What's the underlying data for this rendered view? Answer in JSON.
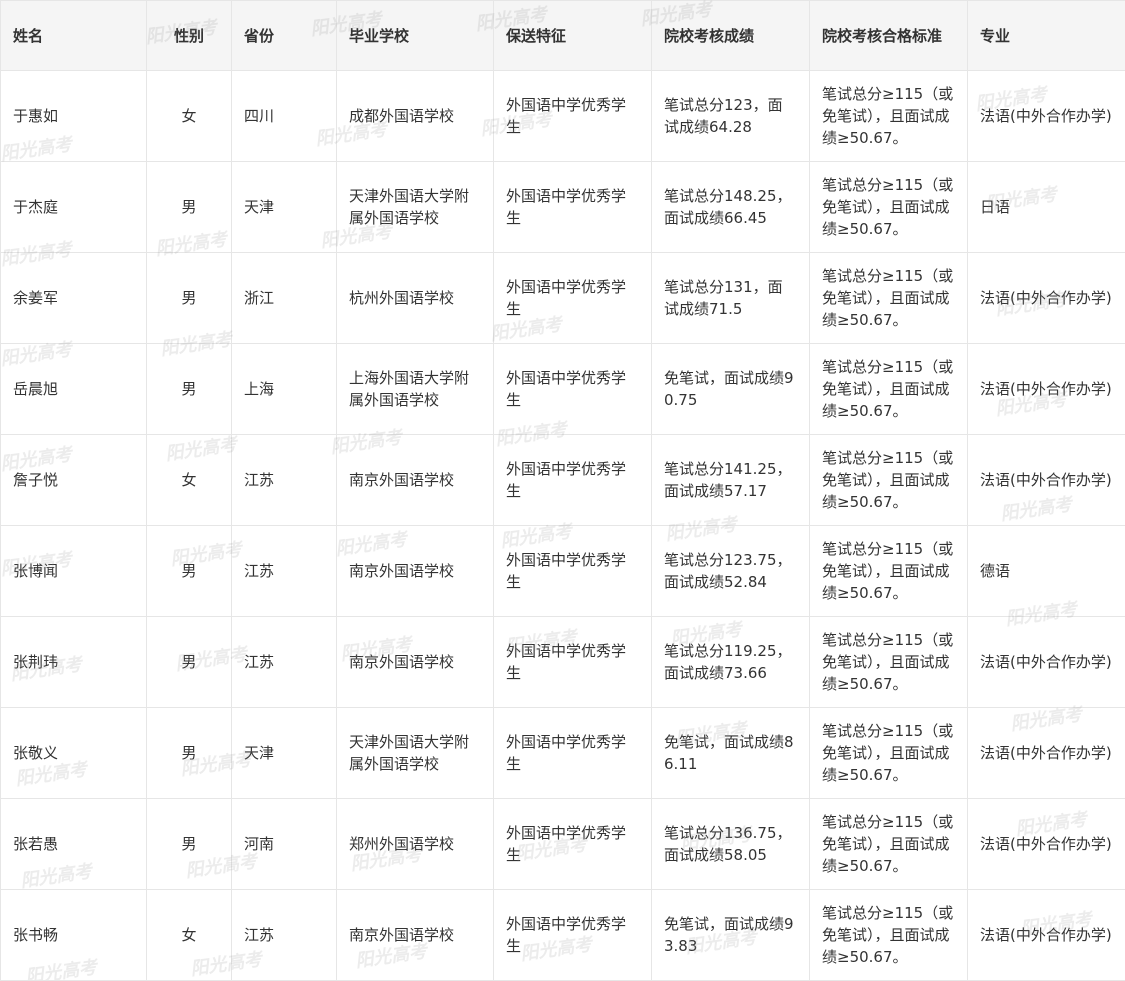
{
  "table": {
    "headers": [
      "姓名",
      "性别",
      "省份",
      "毕业学校",
      "保送特征",
      "院校考核成绩",
      "院校考核合格标准",
      "专业"
    ],
    "rows": [
      [
        "于惠如",
        "女",
        "四川",
        "成都外国语学校",
        "外国语中学优秀学生",
        "笔试总分123，面试成绩64.28",
        "笔试总分≥115（或免笔试），且面试成绩≥50.67。",
        "法语(中外合作办学)"
      ],
      [
        "于杰庭",
        "男",
        "天津",
        "天津外国语大学附属外国语学校",
        "外国语中学优秀学生",
        "笔试总分148.25，面试成绩66.45",
        "笔试总分≥115（或免笔试），且面试成绩≥50.67。",
        "日语"
      ],
      [
        "余姜军",
        "男",
        "浙江",
        "杭州外国语学校",
        "外国语中学优秀学生",
        "笔试总分131，面试成绩71.5",
        "笔试总分≥115（或免笔试），且面试成绩≥50.67。",
        "法语(中外合作办学)"
      ],
      [
        "岳晨旭",
        "男",
        "上海",
        "上海外国语大学附属外国语学校",
        "外国语中学优秀学生",
        "免笔试，面试成绩90.75",
        "笔试总分≥115（或免笔试），且面试成绩≥50.67。",
        "法语(中外合作办学)"
      ],
      [
        "詹子悦",
        "女",
        "江苏",
        "南京外国语学校",
        "外国语中学优秀学生",
        "笔试总分141.25，面试成绩57.17",
        "笔试总分≥115（或免笔试），且面试成绩≥50.67。",
        "法语(中外合作办学)"
      ],
      [
        "张博闻",
        "男",
        "江苏",
        "南京外国语学校",
        "外国语中学优秀学生",
        "笔试总分123.75，面试成绩52.84",
        "笔试总分≥115（或免笔试），且面试成绩≥50.67。",
        "德语"
      ],
      [
        "张荆玮",
        "男",
        "江苏",
        "南京外国语学校",
        "外国语中学优秀学生",
        "笔试总分119.25，面试成绩73.66",
        "笔试总分≥115（或免笔试），且面试成绩≥50.67。",
        "法语(中外合作办学)"
      ],
      [
        "张敬义",
        "男",
        "天津",
        "天津外国语大学附属外国语学校",
        "外国语中学优秀学生",
        "免笔试，面试成绩86.11",
        "笔试总分≥115（或免笔试），且面试成绩≥50.67。",
        "法语(中外合作办学)"
      ],
      [
        "张若愚",
        "男",
        "河南",
        "郑州外国语学校",
        "外国语中学优秀学生",
        "笔试总分136.75，面试成绩58.05",
        "笔试总分≥115（或免笔试），且面试成绩≥50.67。",
        "法语(中外合作办学)"
      ],
      [
        "张书畅",
        "女",
        "江苏",
        "南京外国语学校",
        "外国语中学优秀学生",
        "免笔试，面试成绩93.83",
        "笔试总分≥115（或免笔试），且面试成绩≥50.67。",
        "法语(中外合作办学)"
      ]
    ]
  },
  "watermark": {
    "text": "阳光高考",
    "color": "#969696"
  },
  "colors": {
    "header_bg": "#f5f5f5",
    "border": "#e6e6e6",
    "text": "#333333"
  }
}
